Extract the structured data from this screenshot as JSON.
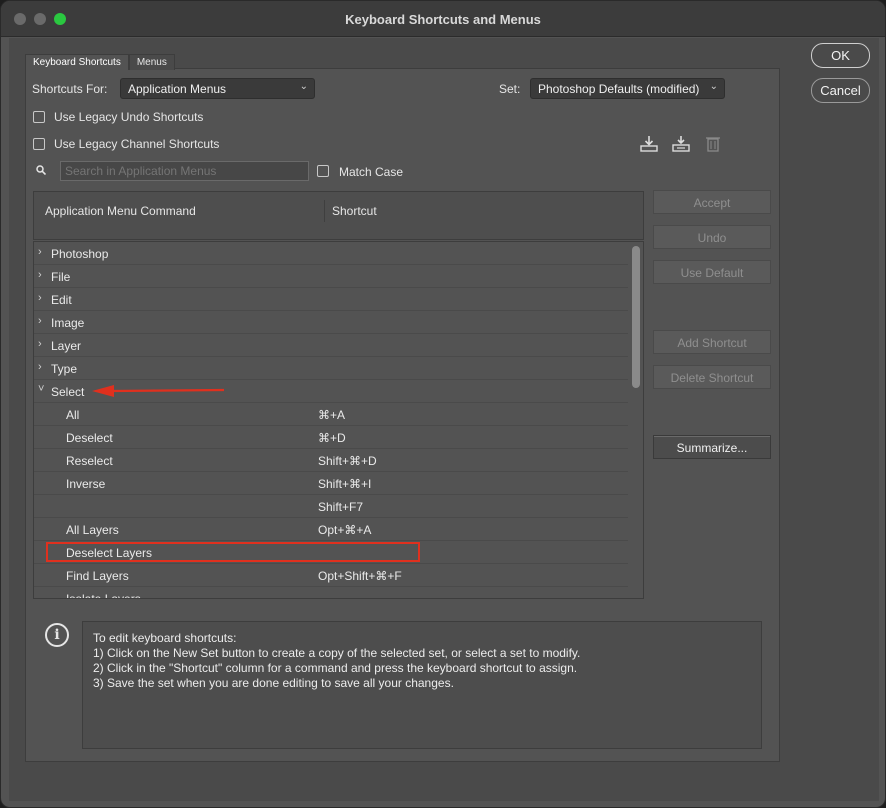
{
  "window": {
    "title": "Keyboard Shortcuts and Menus"
  },
  "tabs": [
    {
      "label": "Keyboard Shortcuts",
      "active": true
    },
    {
      "label": "Menus",
      "active": false
    }
  ],
  "shortcuts_for": {
    "label": "Shortcuts For:",
    "value": "Application Menus"
  },
  "set": {
    "label": "Set:",
    "value": "Photoshop Defaults (modified)"
  },
  "options": {
    "legacy_undo": "Use Legacy Undo Shortcuts",
    "legacy_channel": "Use Legacy Channel Shortcuts",
    "match_case": "Match Case"
  },
  "search": {
    "placeholder": "Search in Application Menus"
  },
  "table": {
    "columns": [
      "Application Menu Command",
      "Shortcut"
    ],
    "rows": [
      {
        "command": "Photoshop",
        "shortcut": "",
        "level": 0,
        "expanded": false
      },
      {
        "command": "File",
        "shortcut": "",
        "level": 0,
        "expanded": false
      },
      {
        "command": "Edit",
        "shortcut": "",
        "level": 0,
        "expanded": false
      },
      {
        "command": "Image",
        "shortcut": "",
        "level": 0,
        "expanded": false
      },
      {
        "command": "Layer",
        "shortcut": "",
        "level": 0,
        "expanded": false
      },
      {
        "command": "Type",
        "shortcut": "",
        "level": 0,
        "expanded": false
      },
      {
        "command": "Select",
        "shortcut": "",
        "level": 0,
        "expanded": true
      },
      {
        "command": "All",
        "shortcut": "⌘+A",
        "level": 1
      },
      {
        "command": "Deselect",
        "shortcut": "⌘+D",
        "level": 1
      },
      {
        "command": "Reselect",
        "shortcut": "Shift+⌘+D",
        "level": 1
      },
      {
        "command": "Inverse",
        "shortcut": "Shift+⌘+I",
        "level": 1
      },
      {
        "command": "",
        "shortcut": "Shift+F7",
        "level": 1
      },
      {
        "command": "All Layers",
        "shortcut": "Opt+⌘+A",
        "level": 1
      },
      {
        "command": "Deselect Layers",
        "shortcut": "",
        "level": 1
      },
      {
        "command": "Find Layers",
        "shortcut": "Opt+Shift+⌘+F",
        "level": 1
      },
      {
        "command": "Isolate Layers",
        "shortcut": "",
        "level": 1
      }
    ]
  },
  "side_buttons": {
    "accept": "Accept",
    "undo": "Undo",
    "use_default": "Use Default",
    "add_shortcut": "Add Shortcut",
    "delete_shortcut": "Delete Shortcut",
    "summarize": "Summarize..."
  },
  "dialog_buttons": {
    "ok": "OK",
    "cancel": "Cancel"
  },
  "info": {
    "lines": [
      "To edit keyboard shortcuts:",
      "1) Click on the New Set button to create a copy of the selected set, or select a set to modify.",
      "2) Click in the \"Shortcut\" column for a command and press the keyboard shortcut to assign.",
      "3) Save the set when you are done editing to save all your changes."
    ]
  },
  "colors": {
    "highlight": "#e0301e",
    "accent_green": "#2ac840",
    "background": "#535353"
  },
  "icons": [
    "search-icon",
    "save-set-icon",
    "new-set-icon",
    "delete-set-icon",
    "info-icon",
    "chevron-right-icon",
    "chevron-down-icon"
  ]
}
